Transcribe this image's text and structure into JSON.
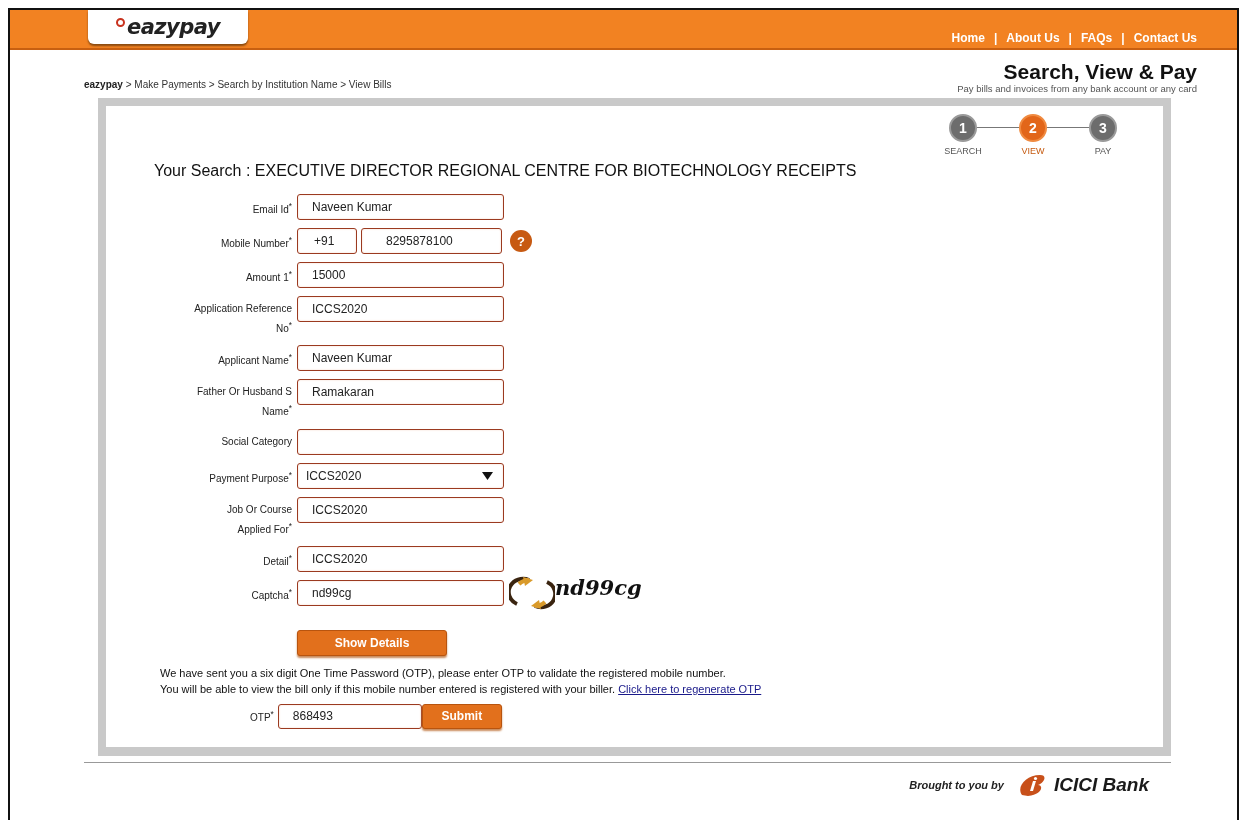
{
  "header": {
    "logo": "eazypay",
    "nav": [
      {
        "label": "Home"
      },
      {
        "separator": "|",
        "label": "About Us"
      },
      {
        "separator": "|",
        "label": "FAQs"
      },
      {
        "separator": "|",
        "label": "Contact Us"
      }
    ]
  },
  "breadcrumb": "**eazypay** > Make Payments > Search by Institution Name > View Bills",
  "page_title": "Search, View & Pay",
  "page_subtitle": "Pay bills and invoices from any bank account or any card",
  "steps": [
    {
      "number": "1",
      "label": "SEARCH",
      "selected": false
    },
    {
      "number": "2",
      "label": "VIEW",
      "selected": true
    },
    {
      "number": "3",
      "label": "PAY",
      "selected": false
    }
  ],
  "search_heading": "Your Search : EXECUTIVE DIRECTOR REGIONAL CENTRE FOR BIOTECHNOLOGY RECEIPTS",
  "fields": [
    {
      "kind": "text",
      "label": "Email Id$^{*}$",
      "value": "Naveen Kumar"
    },
    {
      "kind": "phone",
      "label": "Mobile Number$^{*}$",
      "code": "+91",
      "value": "8295878100",
      "help": "?"
    },
    {
      "kind": "text",
      "label": "Amount 1$^{*}$",
      "value": "15000"
    },
    {
      "kind": "text",
      "label": "Application Reference No$^{*}$",
      "value": "ICCS2020"
    },
    {
      "kind": "text",
      "label": "Applicant Name$^{*}$",
      "value": "Naveen Kumar"
    },
    {
      "kind": "text",
      "label": "Father Or Husband S Name$^{*}$",
      "value": "Ramakaran"
    },
    {
      "kind": "text",
      "label": "Social Category"
    },
    {
      "kind": "select",
      "label": "Payment Purpose$^{*}$",
      "value": "ICCS2020"
    },
    {
      "kind": "text",
      "label": "Job Or Course Applied For$^{*}$",
      "value": "ICCS2020"
    },
    {
      "kind": "text",
      "label": "Detail$^{*}$",
      "value": "ICCS2020"
    },
    {
      "kind": "captcha",
      "label": "Captcha$^{*}$",
      "value": "nd99cg",
      "captcha_text": "nd99cg"
    }
  ],
  "show_details_button": "Show Details",
  "otp_notice": {
    "line_1": "We have sent you a six digit One Time Password (OTP), please enter OTP to validate the registered mobile number.",
    "line_2": "You will be able to view the bill only if this mobile number entered is registered with your biller.",
    "link": "Click here to regenerate OTP"
  },
  "otp": {
    "label": "OTP$^{*}$",
    "value": "868493",
    "button": "Submit"
  },
  "footer": {
    "credit": "Brought to you by",
    "bank": "ICICI Bank"
  }
}
